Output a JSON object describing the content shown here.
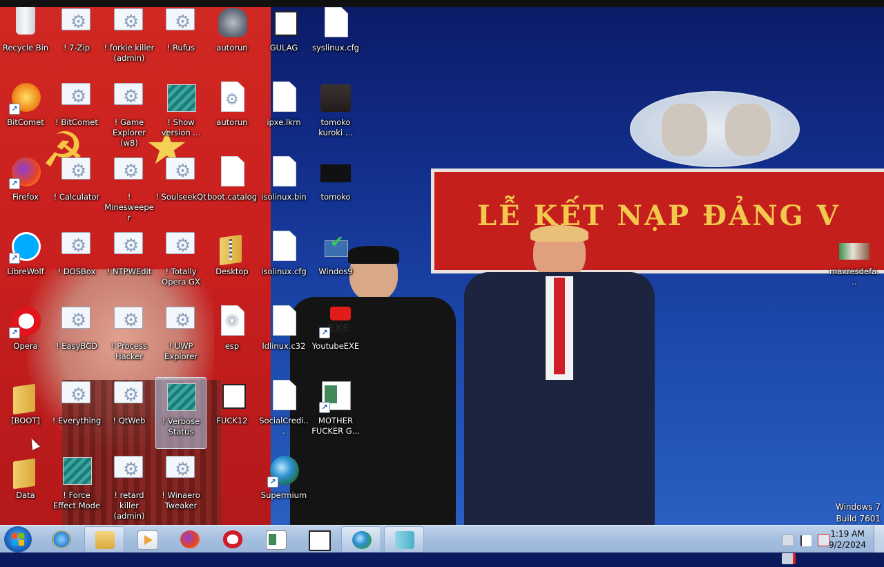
{
  "desktop": {
    "icons": [
      {
        "label": "Recycle Bin",
        "icon": "recycle-bin-icon"
      },
      {
        "label": "! 7-Zip",
        "icon": "app-gear-icon"
      },
      {
        "label": "! forkie killer (admin)",
        "icon": "app-gear-icon"
      },
      {
        "label": "! Rufus",
        "icon": "app-gear-icon"
      },
      {
        "label": "autorun",
        "icon": "wolf-icon"
      },
      {
        "label": "GULAG",
        "icon": "file-icon"
      },
      {
        "label": "syslinux.cfg",
        "icon": "document-icon"
      },
      {
        "label": "BitComet",
        "icon": "bitcomet-icon"
      },
      {
        "label": "! BitComet",
        "icon": "app-gear-icon"
      },
      {
        "label": "! Game Explorer (w8)",
        "icon": "app-gear-icon"
      },
      {
        "label": "! Show version ...",
        "icon": "registry-icon"
      },
      {
        "label": "autorun",
        "icon": "settings-file-icon"
      },
      {
        "label": "ipxe.lkrn",
        "icon": "document-icon"
      },
      {
        "label": "tomoko kuroki ...",
        "icon": "image-thumbnail-icon"
      },
      {
        "label": "Firefox",
        "icon": "firefox-icon"
      },
      {
        "label": "! Calculator",
        "icon": "app-gear-icon"
      },
      {
        "label": "! Minesweeper",
        "icon": "app-gear-icon"
      },
      {
        "label": "! SoulseekQt",
        "icon": "app-gear-icon"
      },
      {
        "label": "boot.catalog",
        "icon": "document-icon"
      },
      {
        "label": "isolinux.bin",
        "icon": "document-icon"
      },
      {
        "label": "tomoko",
        "icon": "image-thumbnail-icon"
      },
      {
        "label": "LibreWolf",
        "icon": "librewolf-icon"
      },
      {
        "label": "! DOSBox",
        "icon": "app-gear-icon"
      },
      {
        "label": "! NTPWEdit",
        "icon": "app-gear-icon"
      },
      {
        "label": "! Totally Opera GX",
        "icon": "app-gear-icon"
      },
      {
        "label": "Desktop",
        "icon": "zip-folder-icon"
      },
      {
        "label": "isolinux.cfg",
        "icon": "document-icon"
      },
      {
        "label": "Windos9",
        "icon": "installer-icon"
      },
      {
        "label": "Opera",
        "icon": "opera-icon"
      },
      {
        "label": "! EasyBCD",
        "icon": "app-gear-icon"
      },
      {
        "label": "! Process Hacker",
        "icon": "app-gear-icon"
      },
      {
        "label": "! UWP Explorer",
        "icon": "app-gear-icon"
      },
      {
        "label": "esp",
        "icon": "disc-image-icon"
      },
      {
        "label": "ldlinux.c32",
        "icon": "document-icon"
      },
      {
        "label": "YoutubeEXE",
        "icon": "youtube-icon"
      },
      {
        "label": "[BOOT]",
        "icon": "folder-icon"
      },
      {
        "label": "! Everything",
        "icon": "app-gear-icon"
      },
      {
        "label": "! QtWeb",
        "icon": "app-gear-icon"
      },
      {
        "label": "! Verbose Status",
        "icon": "registry-icon"
      },
      {
        "label": "FUCK12",
        "icon": "file-icon"
      },
      {
        "label": "SocialCredi...",
        "icon": "document-icon"
      },
      {
        "label": "MOTHER FUCKER G...",
        "icon": "window-app-icon"
      },
      {
        "label": "Data",
        "icon": "folder-icon"
      },
      {
        "label": "! Force Effect Mode",
        "icon": "registry-icon"
      },
      {
        "label": "! retard killer (admin)",
        "icon": "app-gear-icon"
      },
      {
        "label": "! Winaero Tweaker",
        "icon": "app-gear-icon"
      },
      {
        "label": "Supermium",
        "icon": "supermium-icon"
      },
      {
        "label": "maxresdefa...",
        "icon": "image-thumbnail-icon"
      }
    ],
    "banner_text": "LỄ KẾT NẠP ĐẢNG V",
    "watermark": {
      "os": "Windows 7",
      "build": "Build 7601"
    }
  },
  "taskbar": {
    "start_icon": "windows-start-icon",
    "pinned": [
      {
        "name": "internet-explorer",
        "icon": "internet-explorer-icon",
        "color": "#2a7fd4"
      },
      {
        "name": "windows-explorer",
        "icon": "folder-icon",
        "color": "#e9c25a"
      },
      {
        "name": "media-player",
        "icon": "media-player-icon",
        "color": "#f0a040"
      },
      {
        "name": "firefox",
        "icon": "firefox-icon",
        "color": "#e66a1f"
      },
      {
        "name": "opera",
        "icon": "opera-icon",
        "color": "#d11a2a"
      },
      {
        "name": "app-window",
        "icon": "window-app-icon",
        "color": "#3f8a5a"
      },
      {
        "name": "file",
        "icon": "file-icon",
        "color": "#ffffff"
      },
      {
        "name": "supermium",
        "icon": "supermium-icon",
        "color": "#3d9b4b"
      },
      {
        "name": "notepad",
        "icon": "notepad-icon",
        "color": "#4cb0c8"
      }
    ],
    "clock": {
      "time": "1:19 AM",
      "date": "9/2/2024"
    }
  }
}
